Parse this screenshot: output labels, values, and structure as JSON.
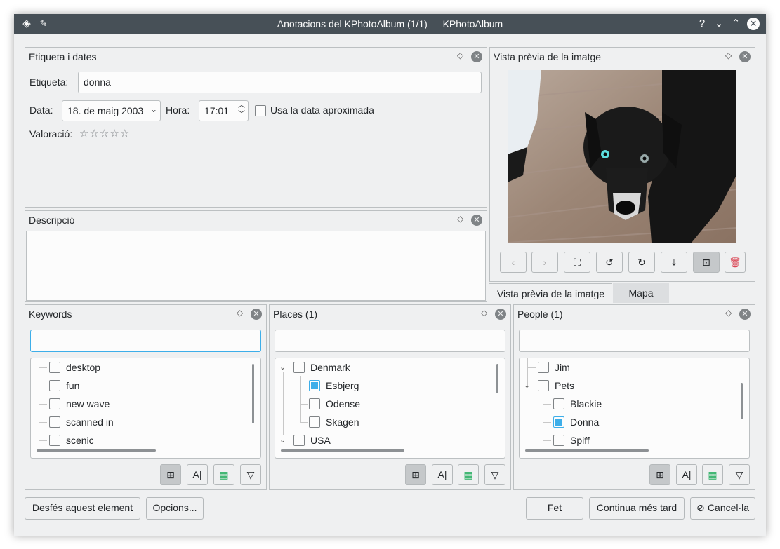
{
  "window": {
    "title": "Anotacions del KPhotoAlbum (1/1) — KPhotoAlbum"
  },
  "label_dates": {
    "title": "Etiqueta i dates",
    "label_caption": "Etiqueta:",
    "label_value": "donna",
    "date_caption": "Data:",
    "date_value": "18. de maig 2003",
    "time_caption": "Hora:",
    "time_value": "17:01",
    "approx_label": "Usa la data aproximada",
    "approx_checked": false,
    "rating_caption": "Valoració:",
    "rating_value": 0,
    "rating_max": 5
  },
  "description": {
    "title": "Descripció",
    "value": ""
  },
  "preview": {
    "title": "Vista prèvia de la imatge",
    "tabs": [
      {
        "label": "Vista prèvia de la imatge",
        "active": true
      },
      {
        "label": "Mapa",
        "active": false
      }
    ]
  },
  "keywords": {
    "title": "Keywords",
    "search_value": "",
    "items": [
      {
        "label": "desktop",
        "checked": false
      },
      {
        "label": "fun",
        "checked": false
      },
      {
        "label": "new wave",
        "checked": false
      },
      {
        "label": "scanned in",
        "checked": false
      },
      {
        "label": "scenic",
        "checked": false
      }
    ]
  },
  "places": {
    "title": "Places (1)",
    "search_value": "",
    "items": [
      {
        "label": "Denmark",
        "checked": false,
        "expanded": true
      },
      {
        "label": "Esbjerg",
        "checked": true
      },
      {
        "label": "Odense",
        "checked": false
      },
      {
        "label": "Skagen",
        "checked": false
      },
      {
        "label": "USA",
        "checked": false,
        "expanded": true
      }
    ]
  },
  "people": {
    "title": "People (1)",
    "search_value": "",
    "items": [
      {
        "label": "Jim",
        "checked": false
      },
      {
        "label": "Pets",
        "checked": false,
        "expanded": true
      },
      {
        "label": "Blackie",
        "checked": false
      },
      {
        "label": "Donna",
        "checked": true
      },
      {
        "label": "Spiff",
        "checked": false
      }
    ]
  },
  "toolbar_labels": {
    "alpha": "A|"
  },
  "buttons": {
    "undo": "Desfés aquest element",
    "options": "Opcions...",
    "done": "Fet",
    "continue_later": "Continua més tard",
    "cancel": "Cancel·la"
  },
  "colors": {
    "titlebar": "#475057",
    "accent": "#3daee9",
    "window_bg": "#eff0f1"
  }
}
